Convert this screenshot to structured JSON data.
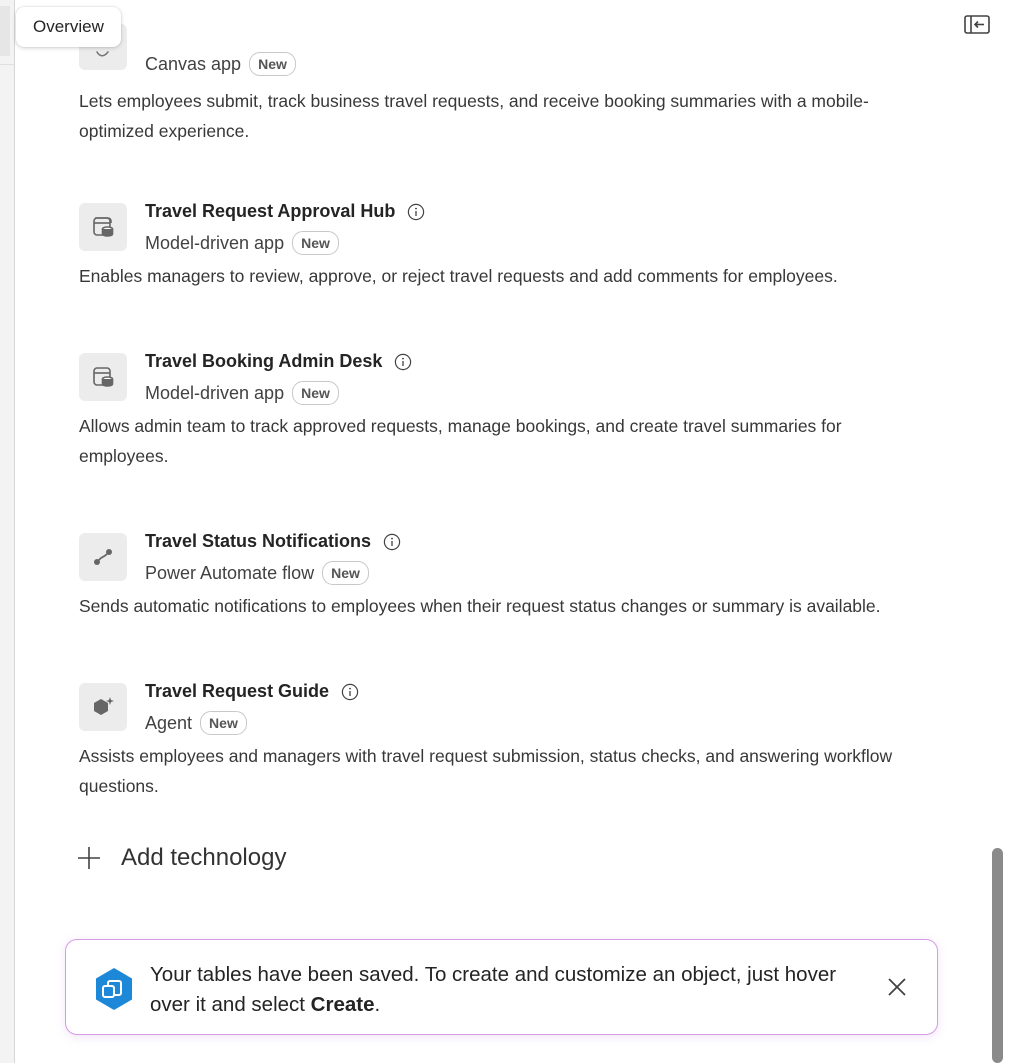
{
  "tooltip": {
    "text": "Overview"
  },
  "items": [
    {
      "title": "",
      "type": "Canvas app",
      "badge": "New",
      "description": "Lets employees submit, track business travel requests, and receive booking summaries with a mobile-optimized experience.",
      "icon": "canvas-app-icon"
    },
    {
      "title": "Travel Request Approval Hub",
      "type": "Model-driven app",
      "badge": "New",
      "description": "Enables managers to review, approve, or reject travel requests and add comments for employees.",
      "icon": "model-driven-app-icon"
    },
    {
      "title": "Travel Booking Admin Desk",
      "type": "Model-driven app",
      "badge": "New",
      "description": "Allows admin team to track approved requests, manage bookings, and create travel summaries for employees.",
      "icon": "model-driven-app-icon"
    },
    {
      "title": "Travel Status Notifications",
      "type": "Power Automate flow",
      "badge": "New",
      "description": "Sends automatic notifications to employees when their request status changes or summary is available.",
      "icon": "flow-icon"
    },
    {
      "title": "Travel Request Guide",
      "type": "Agent",
      "badge": "New",
      "description": "Assists employees and managers with travel request submission, status checks, and answering workflow questions.",
      "icon": "agent-icon"
    }
  ],
  "add_technology": {
    "label": "Add technology"
  },
  "toast": {
    "message_part1": "Your tables have been saved. To create and customize an object, just hover over it and select ",
    "message_bold": "Create",
    "message_end": ".",
    "accent_color": "#d69be6"
  },
  "colors": {
    "scroll_thumb": "#8a8a8a",
    "icon_box": "#ececec",
    "app_icon_blue": "#1e88d8"
  }
}
